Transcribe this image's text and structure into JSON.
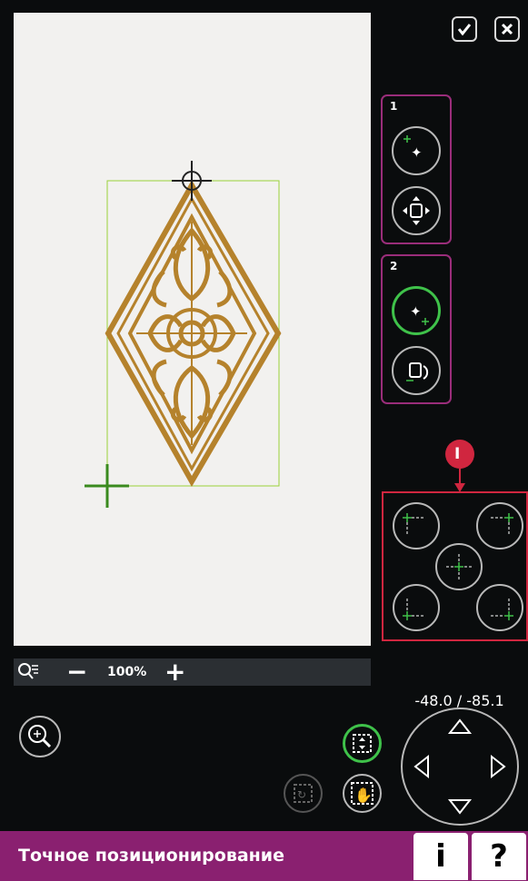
{
  "window": {
    "confirm_icon": "checkmark-icon",
    "close_icon": "close-icon"
  },
  "zoom": {
    "level": "100%",
    "minus_label": "−",
    "plus_label": "+"
  },
  "groups": [
    {
      "number": "1",
      "buttons": [
        "select-design-icon",
        "move-center-icon"
      ]
    },
    {
      "number": "2",
      "buttons": [
        "select-design-active-icon",
        "rotate-icon"
      ]
    }
  ],
  "annotation_marker": "I",
  "corner_buttons": [
    "top-left-corner",
    "top-right-corner",
    "center",
    "bottom-left-corner",
    "bottom-right-corner"
  ],
  "coordinates": "-48.0 / -85.1",
  "bottom_bar": {
    "title": "Точное позиционирование",
    "info_label": "i",
    "help_label": "?"
  },
  "colors": {
    "accent": "#8a2070",
    "group_border": "#9a2d7a",
    "active_green": "#3fc24a",
    "design_gold": "#b5822c",
    "highlight_red": "#d0263f"
  }
}
